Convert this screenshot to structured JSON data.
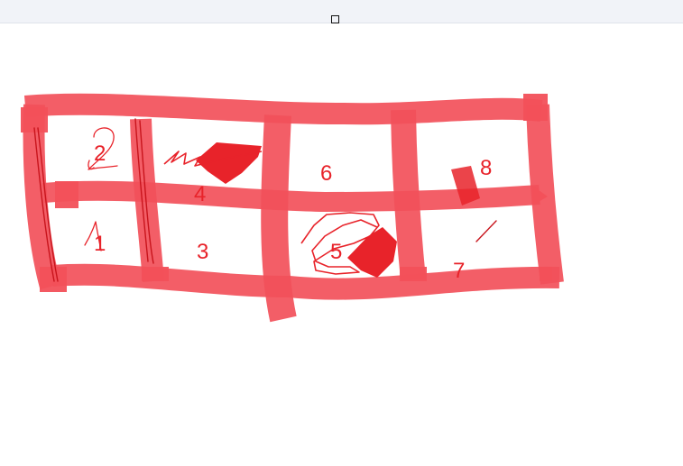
{
  "window": {
    "maximize_icon": "maximize-icon"
  },
  "canvas": {
    "ink_color": "#e8232a",
    "highlight_color": "#f2505a",
    "labels": {
      "one": "1",
      "two": "2",
      "three": "3",
      "four": "4",
      "five": "5",
      "six": "6",
      "seven": "7",
      "eight": "8"
    }
  }
}
